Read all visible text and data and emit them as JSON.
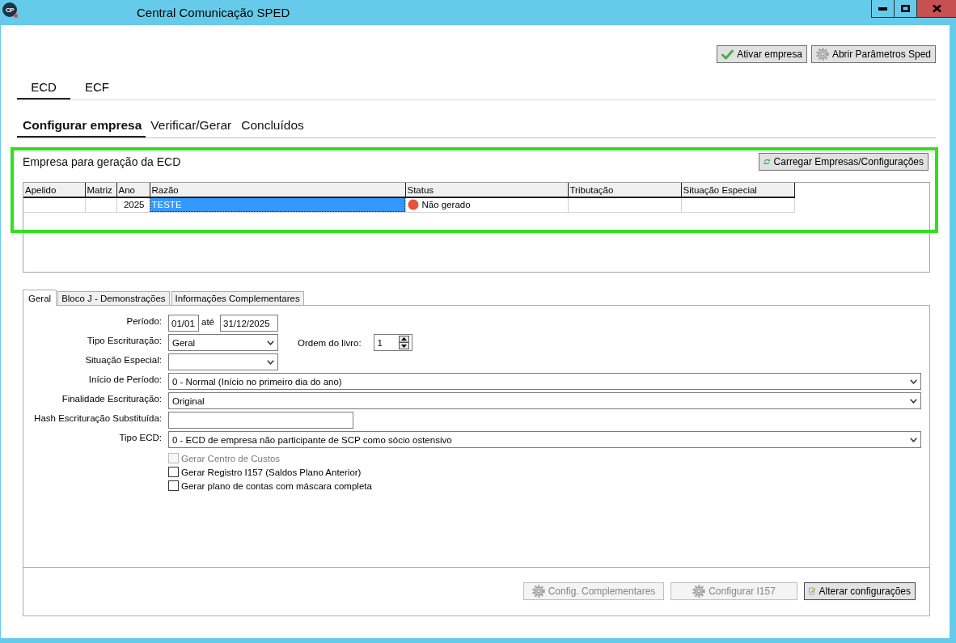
{
  "window": {
    "icon_label": "CP",
    "title": "Central Comunicação SPED"
  },
  "toolbar": {
    "activate_button": {
      "label": "Ativar empresa"
    },
    "parameters_button": {
      "label": "Abrir Parâmetros Sped"
    }
  },
  "main_tabs": [
    {
      "label": "ECD",
      "selected": true
    },
    {
      "label": "ECF",
      "selected": false
    }
  ],
  "sub_tabs": [
    {
      "label": "Configurar empresa",
      "selected": true
    },
    {
      "label": "Verificar/Gerar",
      "selected": false
    },
    {
      "label": "Concluídos",
      "selected": false
    }
  ],
  "company_section": {
    "title": "Empresa para geração da ECD",
    "load_button": {
      "label": "Carregar Empresas/Configurações"
    }
  },
  "table": {
    "columns": [
      "Apelido",
      "Matriz",
      "Ano",
      "Razão",
      "Status",
      "Tributação",
      "Situação Especial"
    ],
    "rows": [
      {
        "cells": [
          {
            "kind": "text",
            "selected": false
          },
          {
            "kind": "text",
            "selected": false
          },
          {
            "kind": "number",
            "text": "2025",
            "selected": false
          },
          {
            "kind": "text",
            "text": "TESTE",
            "selected": true
          },
          {
            "kind": "status",
            "text": "Não gerado",
            "color": "#e5533f",
            "selected": false
          },
          {
            "kind": "text",
            "selected": false
          },
          {
            "kind": "text",
            "selected": false
          }
        ]
      }
    ]
  },
  "settings_tabs": [
    {
      "label": "Geral",
      "selected": true
    },
    {
      "label": "Bloco J - Demonstrações",
      "selected": false
    },
    {
      "label": "Informações Complementares",
      "selected": false
    }
  ],
  "form": {
    "fields": [
      {
        "kind": "date_range",
        "label": "Período:",
        "from": "01/01",
        "separator": "até",
        "to": "31/12/2025"
      },
      {
        "kind": "select_with_spinner",
        "label": "Tipo Escrituração:",
        "value": "Geral",
        "spinner_label": "Ordem do livro:",
        "spinner_value": "1"
      },
      {
        "kind": "small_select",
        "label": "Situação Especial:"
      },
      {
        "kind": "select",
        "label": "Início de Período:",
        "value": "0 - Normal (Início no primeiro dia do ano)"
      },
      {
        "kind": "select",
        "label": "Finalidade Escrituração:",
        "value": "Original"
      },
      {
        "kind": "text_input",
        "label": "Hash Escrituração Substituída:"
      },
      {
        "kind": "select",
        "label": "Tipo ECD:",
        "value": "0 - ECD de empresa não participante de SCP como sócio ostensivo"
      }
    ],
    "checkboxes": [
      {
        "label": "Gerar Centro de Custos",
        "checked": false,
        "disabled": true
      },
      {
        "label": "Gerar Registro I157 (Saldos Plano Anterior)",
        "checked": false,
        "disabled": false
      },
      {
        "label": "Gerar plano de contas com máscara completa",
        "checked": false,
        "disabled": false
      }
    ]
  },
  "footer": {
    "complementary_button": {
      "label": "Config. Complementares",
      "disabled": true
    },
    "i157_button": {
      "label": "Configurar I157",
      "disabled": true
    },
    "change_button": {
      "label": "Alterar configurações",
      "disabled": false
    }
  }
}
